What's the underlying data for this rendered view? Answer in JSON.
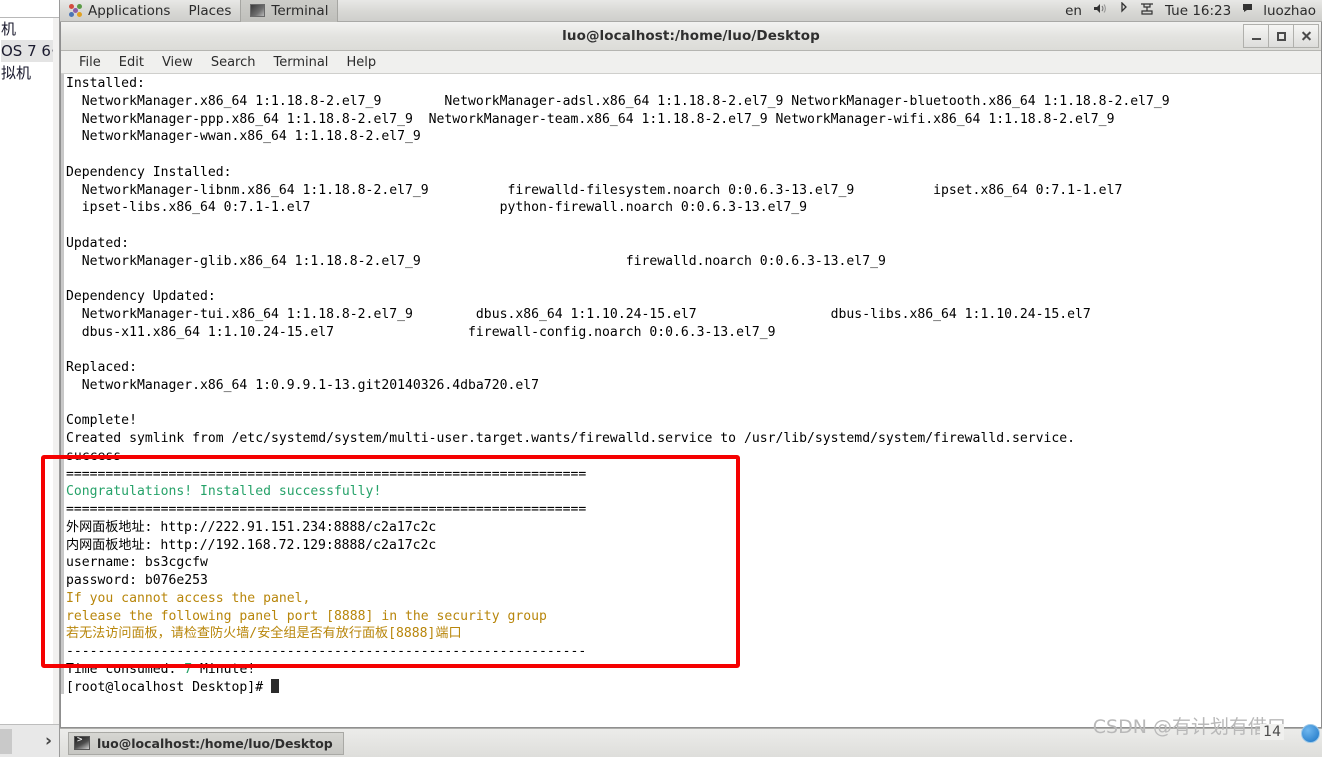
{
  "host": {
    "vm_tree": [
      "机",
      "OS 7 6·",
      "拟机"
    ],
    "expand_label": "›"
  },
  "gnome_bar": {
    "applications": "Applications",
    "places": "Places",
    "terminal": "Terminal",
    "keyboard_layout": "en",
    "clock": "Tue 16:23",
    "user": "luozhao",
    "icons": {
      "apps": "applications-grid-icon",
      "volume": "volume-icon",
      "bluetooth": "bluetooth-icon",
      "network": "network-icon",
      "terminal": "terminal-icon",
      "user": "user-icon"
    }
  },
  "window": {
    "title": "luo@localhost:/home/luo/Desktop",
    "menu": [
      "File",
      "Edit",
      "View",
      "Search",
      "Terminal",
      "Help"
    ],
    "controls": {
      "minimize": "minimize-button",
      "maximize": "maximize-button",
      "close": "close-button"
    }
  },
  "terminal": {
    "lines": [
      {
        "text": "Installed:",
        "color": "default"
      },
      {
        "text": "  NetworkManager.x86_64 1:1.18.8-2.el7_9        NetworkManager-adsl.x86_64 1:1.18.8-2.el7_9 NetworkManager-bluetooth.x86_64 1:1.18.8-2.el7_9",
        "color": "default"
      },
      {
        "text": "  NetworkManager-ppp.x86_64 1:1.18.8-2.el7_9  NetworkManager-team.x86_64 1:1.18.8-2.el7_9 NetworkManager-wifi.x86_64 1:1.18.8-2.el7_9",
        "color": "default"
      },
      {
        "text": "  NetworkManager-wwan.x86_64 1:1.18.8-2.el7_9",
        "color": "default"
      },
      {
        "text": "",
        "color": "default"
      },
      {
        "text": "Dependency Installed:",
        "color": "default"
      },
      {
        "text": "  NetworkManager-libnm.x86_64 1:1.18.8-2.el7_9          firewalld-filesystem.noarch 0:0.6.3-13.el7_9          ipset.x86_64 0:7.1-1.el7",
        "color": "default"
      },
      {
        "text": "  ipset-libs.x86_64 0:7.1-1.el7                        python-firewall.noarch 0:0.6.3-13.el7_9",
        "color": "default"
      },
      {
        "text": "",
        "color": "default"
      },
      {
        "text": "Updated:",
        "color": "default"
      },
      {
        "text": "  NetworkManager-glib.x86_64 1:1.18.8-2.el7_9                          firewalld.noarch 0:0.6.3-13.el7_9",
        "color": "default"
      },
      {
        "text": "",
        "color": "default"
      },
      {
        "text": "Dependency Updated:",
        "color": "default"
      },
      {
        "text": "  NetworkManager-tui.x86_64 1:1.18.8-2.el7_9        dbus.x86_64 1:1.10.24-15.el7                 dbus-libs.x86_64 1:1.10.24-15.el7",
        "color": "default"
      },
      {
        "text": "  dbus-x11.x86_64 1:1.10.24-15.el7                 firewall-config.noarch 0:0.6.3-13.el7_9",
        "color": "default"
      },
      {
        "text": "",
        "color": "default"
      },
      {
        "text": "Replaced:",
        "color": "default"
      },
      {
        "text": "  NetworkManager.x86_64 1:0.9.9.1-13.git20140326.4dba720.el7",
        "color": "default"
      },
      {
        "text": "",
        "color": "default"
      },
      {
        "text": "Complete!",
        "color": "default"
      },
      {
        "text": "Created symlink from /etc/systemd/system/multi-user.target.wants/firewalld.service to /usr/lib/systemd/system/firewalld.service.",
        "color": "default"
      },
      {
        "text": "success",
        "color": "default"
      },
      {
        "text": "==================================================================",
        "color": "default"
      },
      {
        "text": "Congratulations! Installed successfully!",
        "color": "green"
      },
      {
        "text": "==================================================================",
        "color": "default"
      },
      {
        "text": "外网面板地址: http://222.91.151.234:8888/c2a17c2c",
        "color": "default"
      },
      {
        "text": "内网面板地址: http://192.168.72.129:8888/c2a17c2c",
        "color": "default"
      },
      {
        "text": "username: bs3cgcfw",
        "color": "default"
      },
      {
        "text": "password: b076e253",
        "color": "default"
      },
      {
        "text": "If you cannot access the panel,",
        "color": "yellow"
      },
      {
        "text": "release the following panel port [8888] in the security group",
        "color": "yellow"
      },
      {
        "text": "若无法访问面板，请检查防火墙/安全组是否有放行面板[8888]端口",
        "color": "yellow"
      },
      {
        "text": "------------------------------------------------------------------",
        "color": "default"
      }
    ],
    "time_consumed_prefix": "Time consumed: ",
    "time_consumed_value": "7",
    "time_consumed_suffix": " Minute!",
    "prompt": "[root@localhost Desktop]# "
  },
  "taskbar": {
    "window_button": "luo@localhost:/home/luo/Desktop",
    "icon": "terminal-icon"
  },
  "watermark": {
    "text": "CSDN @有计划有借口",
    "page_number": "14"
  },
  "colors": {
    "annotation": "#f50000",
    "success_green": "#26a269",
    "warning_yellow": "#b8860b"
  }
}
